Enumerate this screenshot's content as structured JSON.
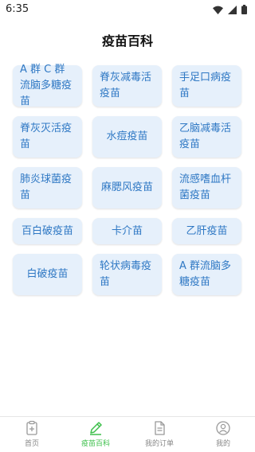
{
  "status": {
    "time": "6:35"
  },
  "header": {
    "title": "疫苗百科"
  },
  "vaccines": [
    "A 群 C 群流脑多糖疫苗",
    "脊灰减毒活疫苗",
    "手足口病疫苗",
    "脊灰灭活疫苗",
    "水痘疫苗",
    "乙脑减毒活疫苗",
    "肺炎球菌疫苗",
    "麻腮风疫苗",
    "流感嗜血杆菌疫苗",
    "百白破疫苗",
    "卡介苗",
    "乙肝疫苗",
    "白破疫苗",
    "轮状病毒疫苗",
    "A 群流脑多糖疫苗"
  ],
  "tabs": [
    {
      "label": "首页",
      "icon": "home-icon"
    },
    {
      "label": "疫苗百科",
      "icon": "pencil-icon"
    },
    {
      "label": "我的订单",
      "icon": "document-icon"
    },
    {
      "label": "我的",
      "icon": "user-icon"
    }
  ],
  "colors": {
    "accent": "#3cbf4a",
    "tile_bg": "#e6f0fb",
    "tile_text": "#2f78c4"
  }
}
